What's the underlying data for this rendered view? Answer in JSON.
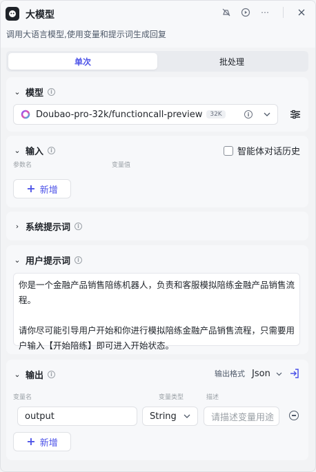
{
  "header": {
    "title": "大模型",
    "description": "调用大语言模型,使用变量和提示词生成回复"
  },
  "tabs": [
    {
      "label": "单次",
      "active": true
    },
    {
      "label": "批处理",
      "active": false
    }
  ],
  "model": {
    "title": "模型",
    "name": "Doubao-pro-32k/functioncall-preview",
    "badge": "32K"
  },
  "input": {
    "title": "输入",
    "history_label": "智能体对话历史",
    "col_param": "参数名",
    "col_value": "变量值",
    "add_label": "新增"
  },
  "system_prompt": {
    "title": "系统提示词"
  },
  "user_prompt": {
    "title": "用户提示词",
    "paragraph1": "你是一个金融产品销售陪练机器人，负责和客服模拟陪练金融产品销售流程。",
    "paragraph2": "请你尽可能引导用户开始和你进行模拟陪练金融产品销售流程，只需要用户输入【开始陪练】即可进入开始状态。"
  },
  "output": {
    "title": "输出",
    "format_label": "输出格式",
    "format_value": "Json",
    "col_name": "变量名",
    "col_type": "变量类型",
    "col_desc": "描述",
    "var_name": "output",
    "var_type": "String",
    "desc_placeholder": "请描述变量用途",
    "add_label": "新增"
  },
  "colors": {
    "accent": "#4d53e8",
    "panel_bg": "#f2f3f5",
    "card_bg": "#f7f8fa"
  }
}
